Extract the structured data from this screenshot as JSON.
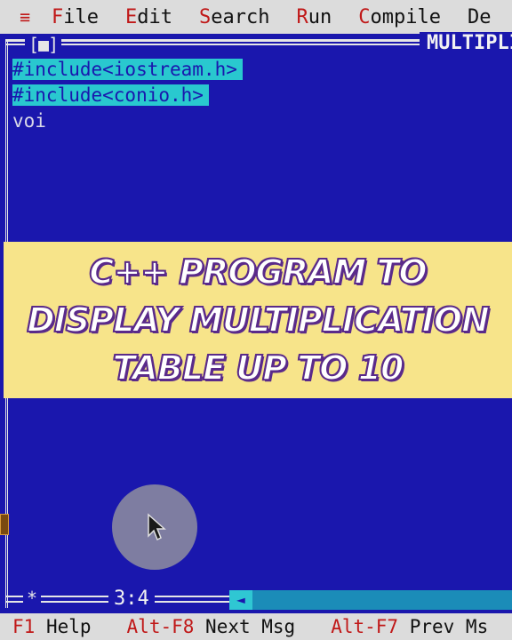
{
  "menu": {
    "system": "≡",
    "items": [
      {
        "hot": "F",
        "rest": "ile"
      },
      {
        "hot": "E",
        "rest": "dit"
      },
      {
        "hot": "S",
        "rest": "earch"
      },
      {
        "hot": "R",
        "rest": "un"
      },
      {
        "hot": "C",
        "rest": "ompile"
      },
      {
        "hot": "",
        "rest": "De"
      }
    ]
  },
  "window": {
    "close_box": "[■]",
    "title": "MULTIPLI"
  },
  "code": {
    "lines": [
      "#include<iostream.h>",
      "#include<conio.h>",
      "voi"
    ]
  },
  "banner": {
    "text": "C++ Program to Display Multiplication Table up to 10"
  },
  "status": {
    "corner": "*",
    "position": "3:4",
    "scroll_arrow": "◄"
  },
  "statusbar": {
    "hints": [
      {
        "key": "F1",
        "label": "Help"
      },
      {
        "key": "Alt-F8",
        "label": "Next Msg"
      },
      {
        "key": "Alt-F7",
        "label": "Prev Ms"
      }
    ]
  },
  "colors": {
    "editor_bg": "#1a17ad",
    "menu_bg": "#dcdcdc",
    "hotkey": "#c01818",
    "selection": "#29c8cf",
    "banner_bg": "#f7e48a"
  }
}
